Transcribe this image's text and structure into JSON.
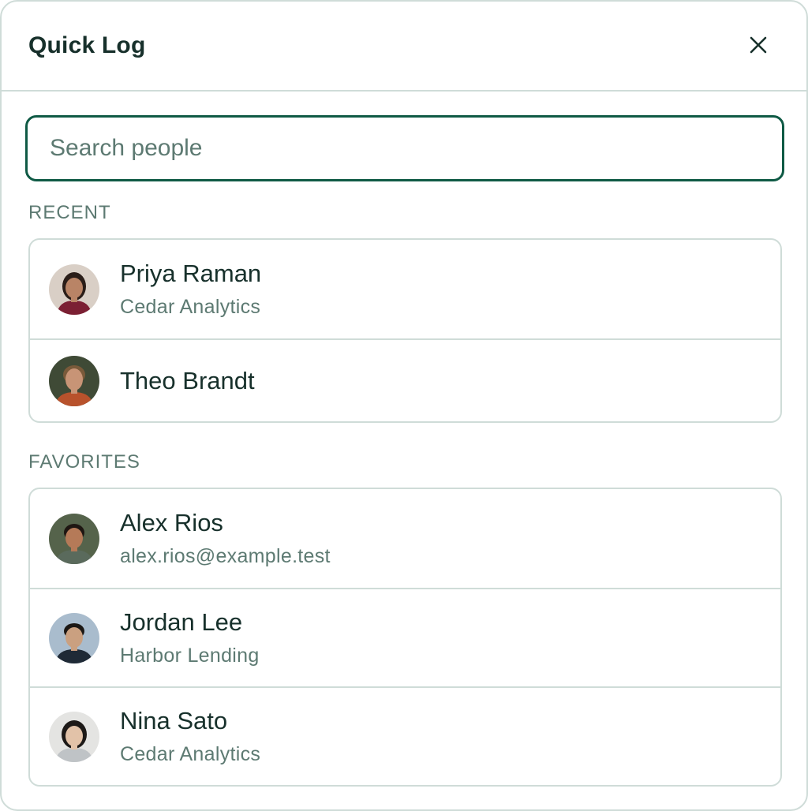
{
  "header": {
    "title": "Quick Log",
    "close_icon": "close-icon"
  },
  "search": {
    "placeholder": "Search people",
    "value": ""
  },
  "recent": {
    "label": "RECENT",
    "people": [
      {
        "name": "Priya Raman",
        "detail": "Cedar Analytics",
        "avatar": "avatar-photo"
      },
      {
        "name": "Theo Brandt",
        "avatar": "avatar-photo"
      }
    ]
  },
  "favorites": {
    "label": "FAVORITES",
    "people": [
      {
        "name": "Alex Rios",
        "detail": "alex.rios@example.test",
        "avatar": "avatar-photo"
      },
      {
        "name": "Jordan Lee",
        "detail": "Harbor Lending",
        "avatar": "avatar-photo"
      },
      {
        "name": "Nina Sato",
        "detail": "Cedar Analytics",
        "avatar": "avatar-photo"
      }
    ]
  },
  "colors": {
    "accent": "#0f5a45",
    "text": "#17302b",
    "muted": "#5d7a72",
    "border": "#cfdcd8"
  }
}
